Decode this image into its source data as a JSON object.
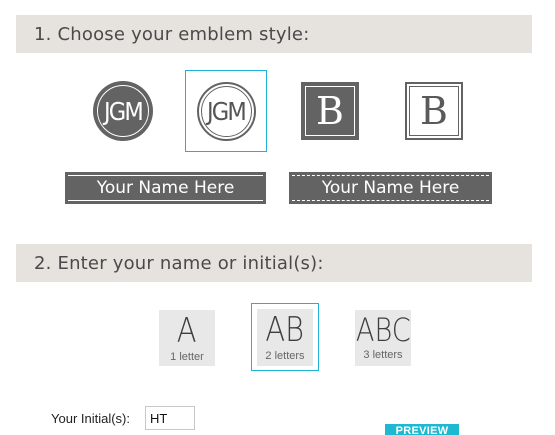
{
  "section1": {
    "title": "1. Choose your emblem style:"
  },
  "emblems": {
    "monogram_filled": "JGM",
    "monogram_outline": "JGM",
    "square_filled": "B",
    "square_outline": "B",
    "banner_solid": "Your Name Here",
    "banner_dashed": "Your Name Here"
  },
  "section2": {
    "title": "2. Enter your name or initial(s):"
  },
  "letter_options": [
    {
      "glyph": "A",
      "caption": "1 letter"
    },
    {
      "glyph": "AB",
      "caption": "2 letters"
    },
    {
      "glyph": "ABC",
      "caption": "3 letters"
    }
  ],
  "form": {
    "initials_label": "Your Initial(s):",
    "initials_value": "HT",
    "preview_label": "PREVIEW"
  },
  "colors": {
    "accent": "#1fb2d6",
    "emblem_gray": "#636363",
    "header_bg": "#e6e3de"
  }
}
